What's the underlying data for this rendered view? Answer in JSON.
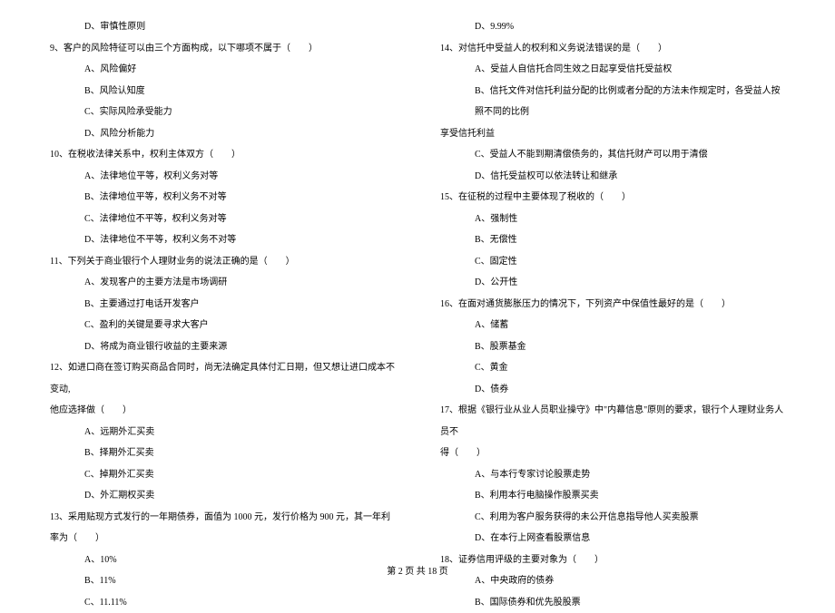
{
  "left": {
    "l0": "D、审慎性原则",
    "q9": "9、客户的风险特征可以由三个方面构成，以下哪项不属于（　　）",
    "q9a": "A、风险偏好",
    "q9b": "B、风险认知度",
    "q9c": "C、实际风险承受能力",
    "q9d": "D、风险分析能力",
    "q10": "10、在税收法律关系中，权利主体双方（　　）",
    "q10a": "A、法律地位平等，权利义务对等",
    "q10b": "B、法律地位平等，权利义务不对等",
    "q10c": "C、法律地位不平等，权利义务对等",
    "q10d": "D、法律地位不平等，权利义务不对等",
    "q11": "11、下列关于商业银行个人理财业务的说法正确的是（　　）",
    "q11a": "A、发现客户的主要方法是市场调研",
    "q11b": "B、主要通过打电话开发客户",
    "q11c": "C、盈利的关键是要寻求大客户",
    "q11d": "D、将成为商业银行收益的主要来源",
    "q12a": "12、如进口商在签订购买商品合同时，尚无法确定具体付汇日期，但又想让进口成本不变动,",
    "q12b": "他应选择做（　　）",
    "q12oa": "A、远期外汇买卖",
    "q12ob": "B、择期外汇买卖",
    "q12oc": "C、掉期外汇买卖",
    "q12od": "D、外汇期权买卖",
    "q13": "13、采用贴现方式发行的一年期债券，面值为 1000 元，发行价格为 900 元，其一年利率为（　　）",
    "q13a": "A、10%",
    "q13b": "B、11%",
    "q13c": "C、11.11%"
  },
  "right": {
    "r0": "D、9.99%",
    "q14": "14、对信托中受益人的权利和义务说法错误的是（　　）",
    "q14a": "A、受益人自信托合同生效之日起享受信托受益权",
    "q14b1": "B、信托文件对信托利益分配的比例或者分配的方法未作规定时，各受益人按照不同的比例",
    "q14b2": "享受信托利益",
    "q14c": "C、受益人不能到期清偿债务的，其信托财产可以用于清偿",
    "q14d": "D、信托受益权可以依法转让和继承",
    "q15": "15、在征税的过程中主要体现了税收的（　　）",
    "q15a": "A、强制性",
    "q15b": "B、无偿性",
    "q15c": "C、固定性",
    "q15d": "D、公开性",
    "q16": "16、在面对通货膨胀压力的情况下，下列资产中保值性最好的是（　　）",
    "q16a": "A、储蓄",
    "q16b": "B、股票基金",
    "q16c": "C、黄金",
    "q16d": "D、债券",
    "q17a": "17、根据《银行业从业人员职业操守》中\"内幕信息\"原则的要求，银行个人理财业务人员不",
    "q17b": "得（　　）",
    "q17oa": "A、与本行专家讨论股票走势",
    "q17ob": "B、利用本行电脑操作股票买卖",
    "q17oc": "C、利用为客户服务获得的未公开信息指导他人买卖股票",
    "q17od": "D、在本行上网查看股票信息",
    "q18": "18、证券信用评级的主要对象为（　　）",
    "q18a": "A、中央政府的债券",
    "q18b": "B、国际债券和优先股股票"
  },
  "footer": "第 2 页 共 18 页"
}
